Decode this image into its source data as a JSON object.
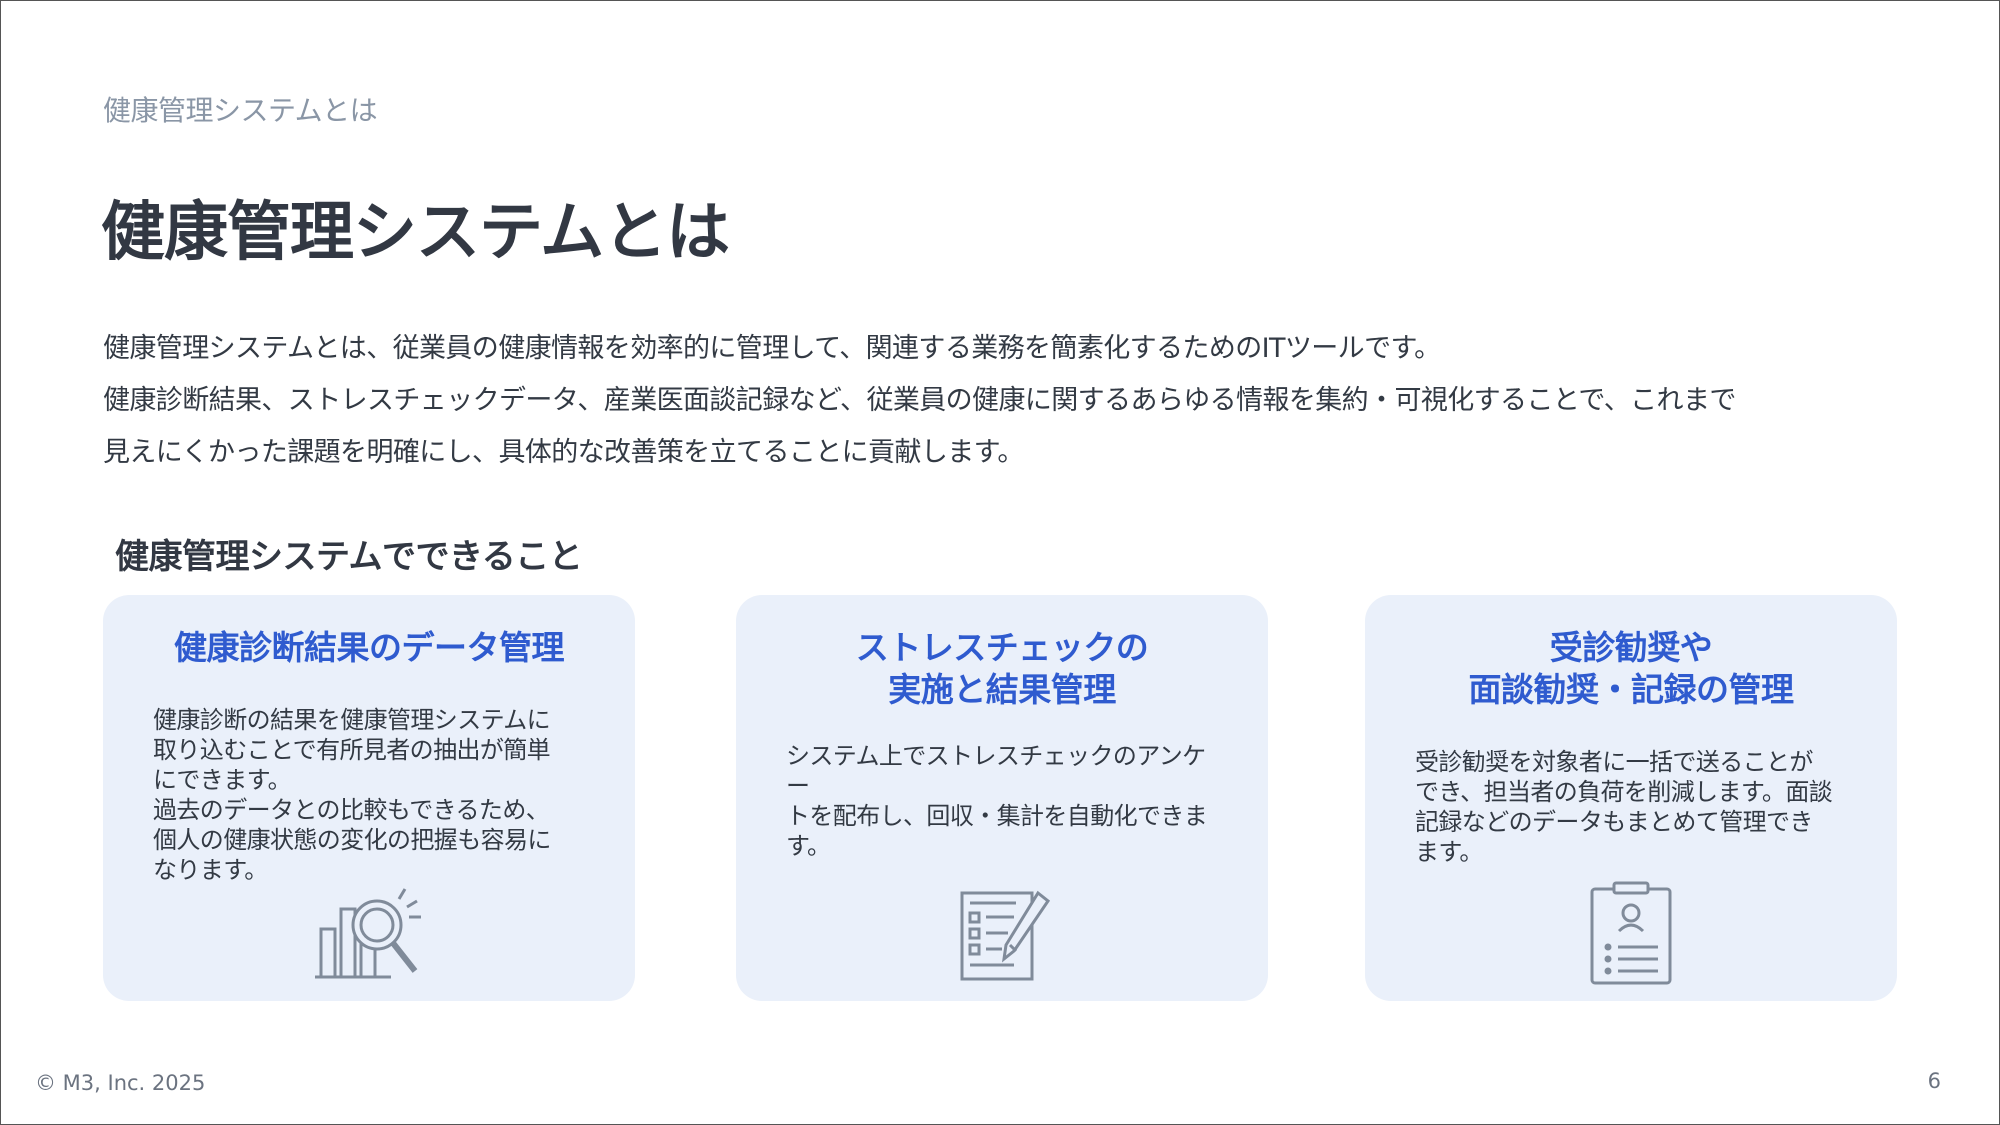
{
  "breadcrumb": "健康管理システムとは",
  "title": "健康管理システムとは",
  "intro": {
    "line1": "健康管理システムとは、従業員の健康情報を効率的に管理して、関連する業務を簡素化するためのITツールです。",
    "line2": "健康診断結果、ストレスチェックデータ、産業医面談記録など、従業員の健康に関するあらゆる情報を集約・可視化することで、これまで",
    "line3": "見えにくかった課題を明確にし、具体的な改善策を立てることに貢献します。"
  },
  "section_title": "健康管理システムでできること",
  "cards": [
    {
      "title_lines": [
        "健康診断結果のデータ管理"
      ],
      "body_lines": [
        "健康診断の結果を健康管理システムに",
        "取り込むことで有所見者の抽出が簡単",
        "にできます。",
        "過去のデータとの比較もできるため、",
        "個人の健康状態の変化の把握も容易に",
        "なります。"
      ],
      "icon": "chart-magnifier-icon"
    },
    {
      "title_lines": [
        "ストレスチェックの",
        "実施と結果管理"
      ],
      "body_lines": [
        "システム上でストレスチェックのアンケー",
        "トを配布し、回収・集計を自動化できま",
        "す。"
      ],
      "icon": "checklist-pen-icon"
    },
    {
      "title_lines": [
        "受診勧奨や",
        "面談勧奨・記録の管理"
      ],
      "body_lines": [
        "受診勧奨を対象者に一括で送ることが",
        "でき、担当者の負荷を削減します。面談",
        "記録などのデータもまとめて管理でき",
        "ます。"
      ],
      "icon": "clipboard-person-icon"
    }
  ],
  "footer": {
    "copyright": "© M3, Inc. 2025",
    "page_number": "6"
  },
  "colors": {
    "accent": "#2f5bcf",
    "card_bg": "#eaf0fa",
    "icon": "#808b9a"
  }
}
